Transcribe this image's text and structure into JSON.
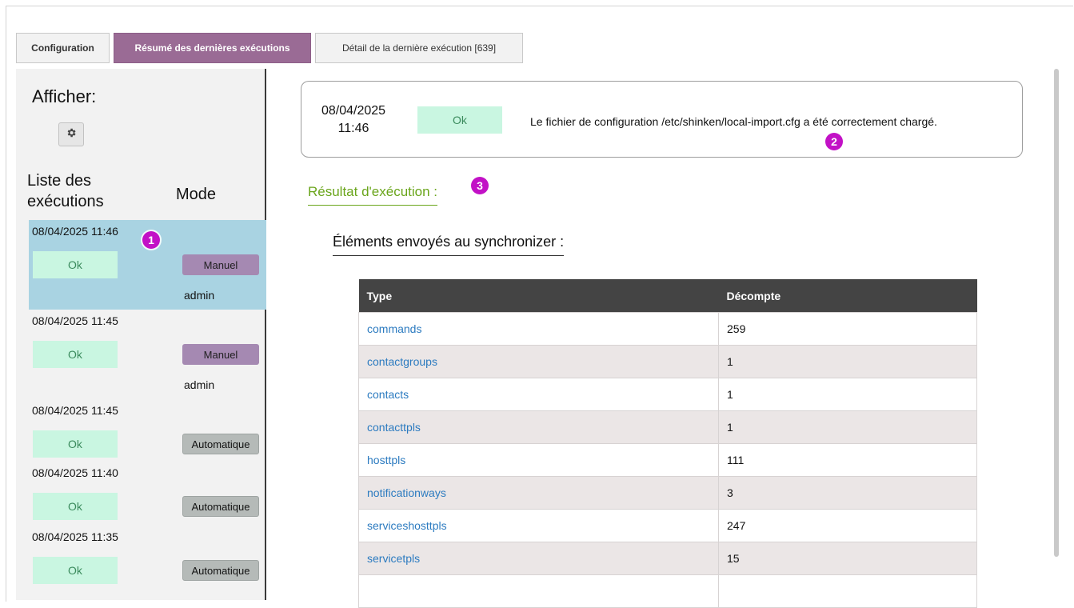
{
  "tabs": [
    {
      "label": "Configuration"
    },
    {
      "label": "Résumé des dernières exécutions"
    },
    {
      "label": "Détail de la dernière exécution [639]"
    }
  ],
  "sidebar": {
    "afficher_label": "Afficher:",
    "settings_icon": "gear-icon",
    "col_liste_line1": "Liste des",
    "col_liste_line2": "exécutions",
    "col_mode": "Mode",
    "executions": [
      {
        "datetime": "08/04/2025 11:46",
        "status": "Ok",
        "mode": "Manuel",
        "user": "admin",
        "selected": true
      },
      {
        "datetime": "08/04/2025 11:45",
        "status": "Ok",
        "mode": "Manuel",
        "user": "admin",
        "selected": false
      },
      {
        "datetime": "08/04/2025 11:45",
        "status": "Ok",
        "mode": "Automatique",
        "user": "",
        "selected": false
      },
      {
        "datetime": "08/04/2025 11:40",
        "status": "Ok",
        "mode": "Automatique",
        "user": "",
        "selected": false
      },
      {
        "datetime": "08/04/2025 11:35",
        "status": "Ok",
        "mode": "Automatique",
        "user": "",
        "selected": false
      }
    ]
  },
  "summary": {
    "date_line1": "08/04/2025",
    "date_line2": "11:46",
    "status": "Ok",
    "message": "Le fichier de configuration /etc/shinken/local-import.cfg a été correctement chargé."
  },
  "markers": [
    "1",
    "2",
    "3"
  ],
  "result": {
    "title": "Résultat d'exécution :",
    "elements_title": "Éléments envoyés au synchronizer :",
    "table": {
      "headers": [
        "Type",
        "Décompte"
      ],
      "rows": [
        {
          "type": "commands",
          "count": "259"
        },
        {
          "type": "contactgroups",
          "count": "1"
        },
        {
          "type": "contacts",
          "count": "1"
        },
        {
          "type": "contacttpls",
          "count": "1"
        },
        {
          "type": "hosttpls",
          "count": "111"
        },
        {
          "type": "notificationways",
          "count": "3"
        },
        {
          "type": "serviceshosttpls",
          "count": "247"
        },
        {
          "type": "servicetpls",
          "count": "15"
        }
      ]
    }
  },
  "colors": {
    "active_tab": "#9a6b95",
    "ok_bg": "#c9f6e1",
    "manual_bg": "#a589b2",
    "auto_bg": "#b5bab8",
    "selected_row": "#a9d3e2",
    "result_title": "#6aa51b",
    "table_header": "#444444",
    "link": "#2c7bc0",
    "marker": "#c211c6"
  }
}
